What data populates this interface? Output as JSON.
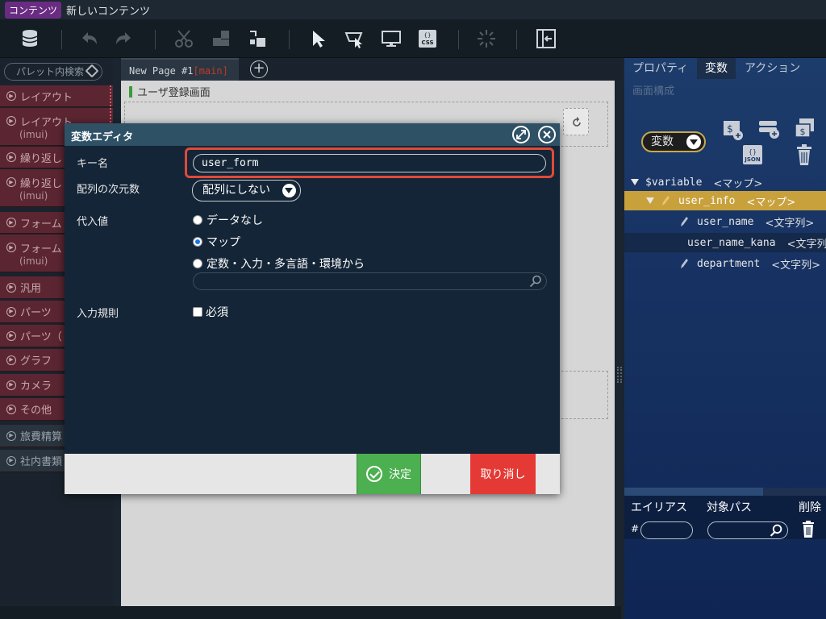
{
  "app": {
    "badge": "コンテンツ",
    "title": "新しいコンテンツ"
  },
  "palette": {
    "search_placeholder": "パレット内検索",
    "items": [
      {
        "label": "レイアウト",
        "sub": ""
      },
      {
        "label": "レイアウト",
        "sub": "(imui)"
      },
      {
        "label": "繰り返し",
        "sub": ""
      },
      {
        "label": "繰り返し",
        "sub": "(imui)"
      },
      {
        "label": "フォーム",
        "sub": ""
      },
      {
        "label": "フォーム",
        "sub": "(imui)"
      },
      {
        "label": "汎用",
        "sub": ""
      },
      {
        "label": "パーツ",
        "sub": ""
      },
      {
        "label": "パーツ（",
        "sub": ""
      },
      {
        "label": "グラフ",
        "sub": ""
      },
      {
        "label": "カメラ",
        "sub": ""
      },
      {
        "label": "その他",
        "sub": ""
      },
      {
        "label": "旅費精算",
        "sub": ""
      },
      {
        "label": "社内書類",
        "sub": ""
      }
    ]
  },
  "canvas": {
    "tab_name": "New Page #1",
    "tab_suffix": "[main]",
    "screen_label": "ユーザ登録画面"
  },
  "right_panel": {
    "tabs": [
      "プロパティ",
      "変数",
      "アクション"
    ],
    "active_tab": "変数",
    "subtitle": "画面構成",
    "var_dropdown": "変数",
    "tree": [
      {
        "name": "$variable",
        "type": "<マップ>",
        "level": 0
      },
      {
        "name": "user_info",
        "type": "<マップ>",
        "level": 1
      },
      {
        "name": "user_name",
        "type": "<文字列>",
        "level": 2
      },
      {
        "name": "user_name_kana",
        "type": "<文字列>",
        "level": 2
      },
      {
        "name": "department",
        "type": "<文字列>",
        "level": 2
      }
    ],
    "alias_header": {
      "alias": "エイリアス",
      "target": "対象パス",
      "delete": "削除"
    },
    "alias_hash": "#"
  },
  "modal": {
    "title": "変数エディタ",
    "key_label": "キー名",
    "key_value": "user_form",
    "dims_label": "配列の次元数",
    "dims_value": "配列にしない",
    "assign_label": "代入値",
    "radio_options": [
      "データなし",
      "マップ",
      "定数・入力・多言語・環境から"
    ],
    "selected_option": "マップ",
    "rule_label": "入力規則",
    "required_label": "必須",
    "ok_label": "決定",
    "cancel_label": "取り消し"
  },
  "colors": {
    "highlight": "#e04a3a",
    "ok": "#4caf50",
    "cancel": "#e53935",
    "selected_row": "#c9a13c"
  }
}
